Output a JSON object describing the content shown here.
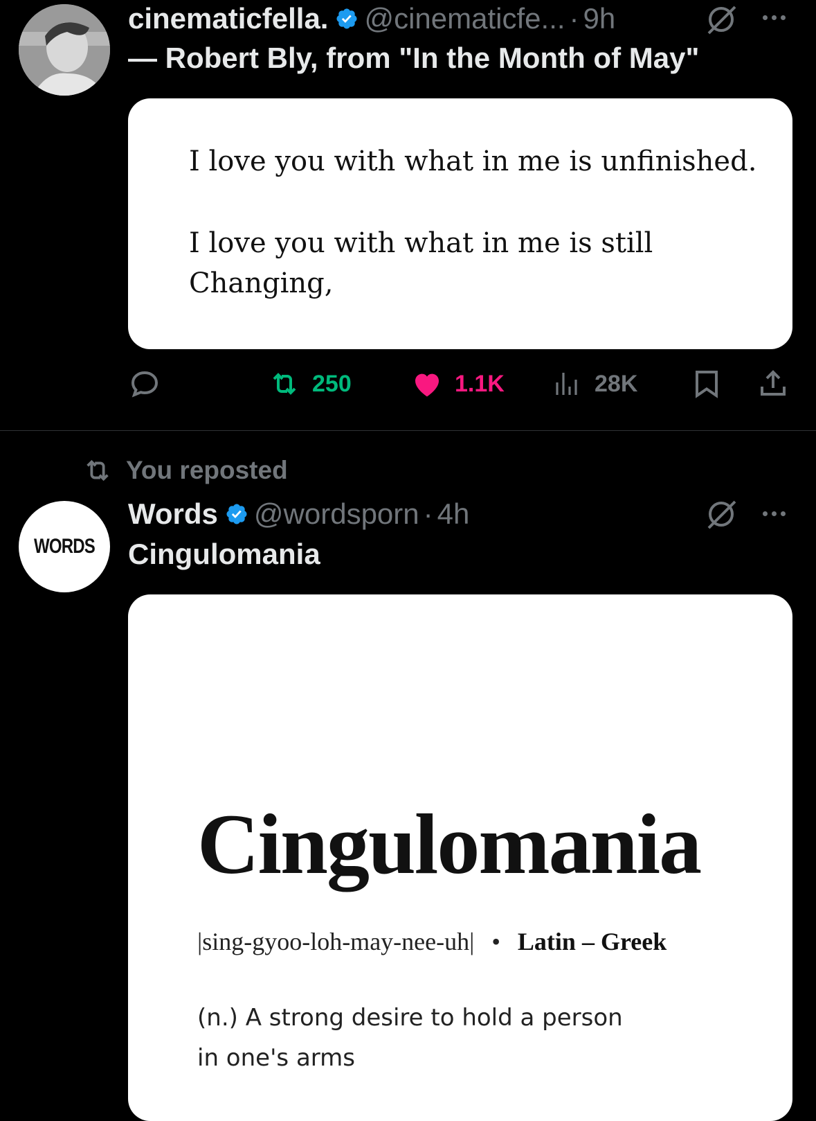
{
  "tweets": [
    {
      "display_name": "cinematicfella.",
      "handle": "@cinematicfe...",
      "separator": "·",
      "time": "9h",
      "text": "— Robert Bly, from \"In the Month of May\"",
      "card": {
        "lines": [
          "I love you with what in me is unfinished.",
          "I love you with what in me is still",
          "Changing,"
        ]
      },
      "actions": {
        "retweets": "250",
        "likes": "1.1K",
        "views": "28K"
      }
    },
    {
      "repost_label": "You reposted",
      "display_name": "Words",
      "avatar_text": "WORDS",
      "handle": "@wordsporn",
      "separator": "·",
      "time": "4h",
      "text": "Cingulomania",
      "card": {
        "word": "Cingulomania",
        "pronunciation": "|sing-gyoo-loh-may-nee-uh|",
        "bullet": "•",
        "origin": "Latin – Greek",
        "definition_line1": "(n.) A strong desire to hold a person",
        "definition_line2": "in one's arms"
      }
    }
  ],
  "colors": {
    "background": "#000000",
    "verified": "#1d9bf0",
    "retweet": "#00ba7c",
    "like": "#f91880",
    "muted": "#71767b"
  },
  "icons": [
    "verified-badge-icon",
    "grok-icon",
    "more-icon",
    "reply-icon",
    "retweet-icon",
    "like-icon",
    "views-icon",
    "bookmark-icon",
    "share-icon",
    "repost-icon"
  ]
}
